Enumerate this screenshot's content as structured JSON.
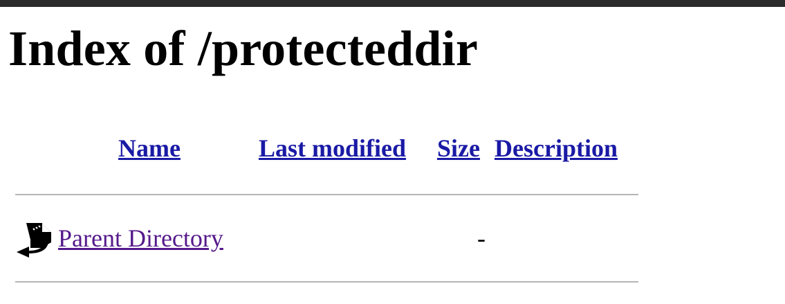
{
  "page": {
    "title": "Index of /protecteddir"
  },
  "table": {
    "headers": {
      "name": "Name",
      "last_modified": "Last modified",
      "size": "Size",
      "description": "Description"
    },
    "rows": [
      {
        "icon": "back-arrow-icon",
        "name": "Parent Directory",
        "last_modified": "",
        "size": "-",
        "description": ""
      }
    ]
  },
  "colors": {
    "link": "#1a1aa6",
    "visited_link": "#551a8b",
    "rule": "#b5b5b5",
    "top_bar": "#2b2b2b"
  }
}
